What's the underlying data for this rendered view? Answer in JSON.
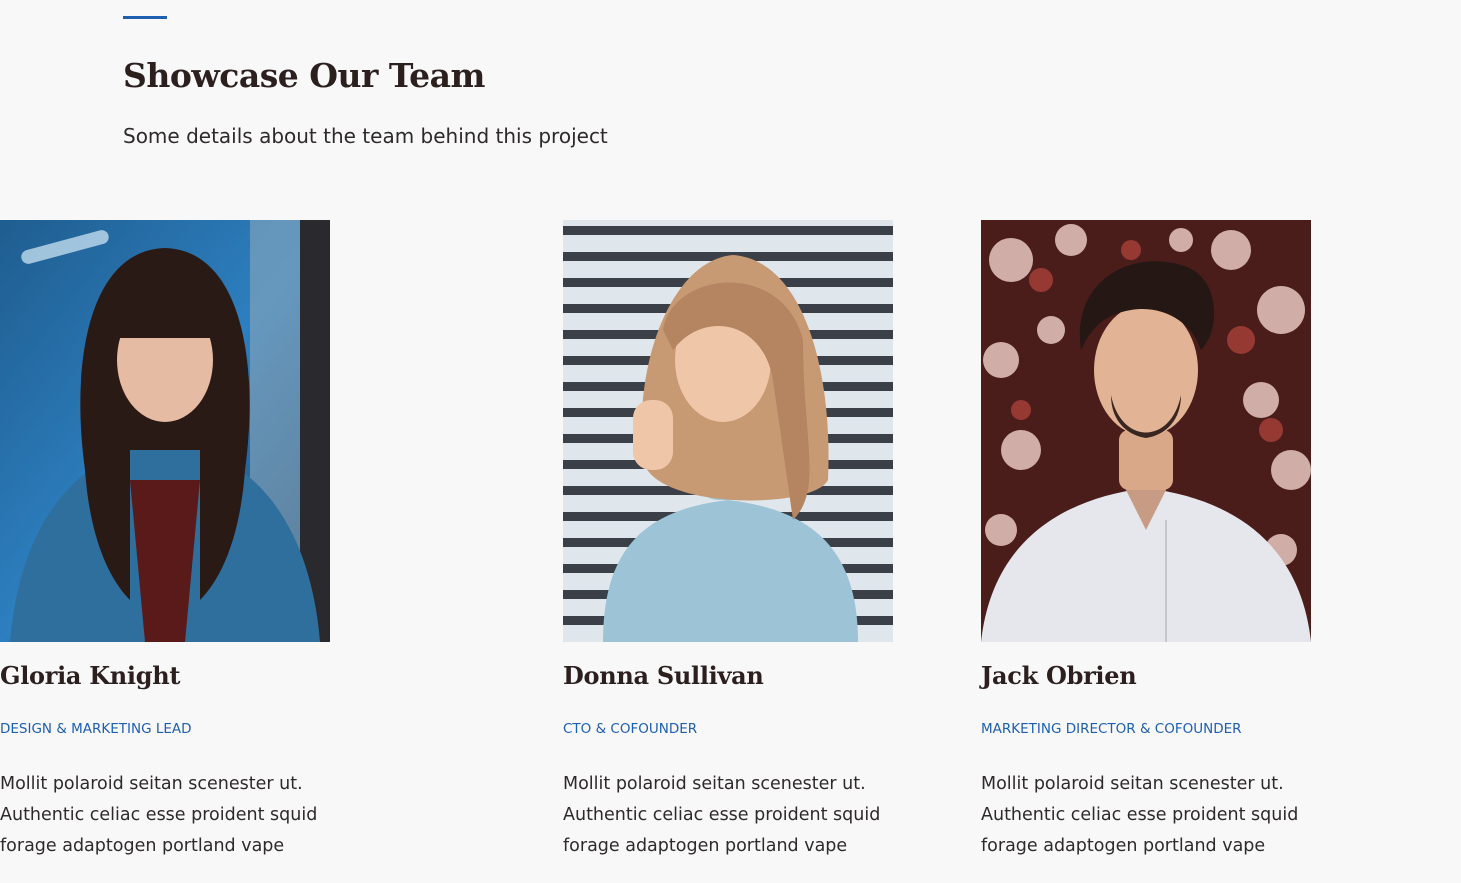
{
  "section": {
    "title": "Showcase Our Team",
    "subtitle": "Some details about the team behind this project",
    "accent_color": "#1d5fb0"
  },
  "team": [
    {
      "name": "Donna Sullivan",
      "role": "CTO & COFOUNDER",
      "bio": "Mollit polaroid seitan scenester ut. Authentic celiac esse proident squid forage adaptogen portland vape",
      "photo": "woman-light-blue-turtleneck-photo"
    },
    {
      "name": "Jack Obrien",
      "role": "MARKETING DIRECTOR & COFOUNDER",
      "bio": "Mollit polaroid seitan scenester ut. Authentic celiac esse proident squid forage adaptogen portland vape",
      "photo": "man-white-shirt-flowers-photo"
    },
    {
      "name": "Gloria Knight",
      "role": "DESIGN & MARKETING LEAD",
      "bio": "Mollit polaroid seitan scenester ut. Authentic celiac esse proident squid forage adaptogen portland vape",
      "photo": "woman-denim-jacket-photo"
    }
  ]
}
